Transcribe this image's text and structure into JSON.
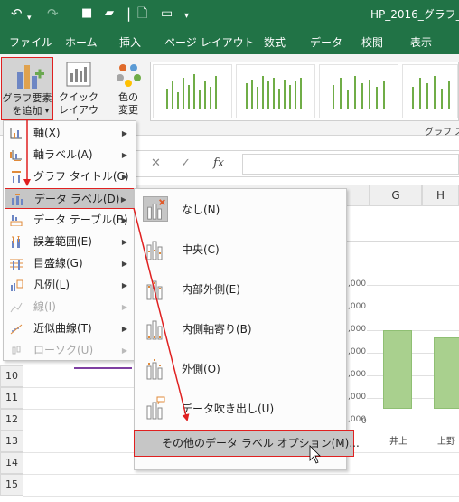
{
  "window": {
    "title": "HP_2016_グラフ_デ"
  },
  "quick_access": {
    "undo": "↶",
    "redo": "↷",
    "save": "■",
    "folder": "▰",
    "new": "🗋",
    "print": "▭",
    "more": "▾"
  },
  "tabs": [
    "ファイル",
    "ホーム",
    "挿入",
    "ページ レイアウト",
    "数式",
    "データ",
    "校閲",
    "表示"
  ],
  "ribbon": {
    "add_element": {
      "line1": "グラフ要素",
      "line2": "を追加"
    },
    "quick_layout": {
      "line1": "クイック",
      "line2": "レイアウト"
    },
    "change_color": {
      "line1": "色の",
      "line2": "変更"
    },
    "group_label": "グラフ ス"
  },
  "formula_bar": {
    "cancel": "✕",
    "enter": "✓",
    "fx": "fx",
    "value": ""
  },
  "columns": [
    "G",
    "H"
  ],
  "rows": [
    "10",
    "11",
    "12",
    "13",
    "14",
    "15"
  ],
  "chart": {
    "yticks": [
      ",000",
      ",000",
      ",000",
      ",000",
      ",000",
      ",000",
      ",000",
      "0"
    ],
    "categories": [
      "井上",
      "上野"
    ],
    "bar_fraction": [
      0.575,
      0.523
    ]
  },
  "menu": {
    "items": [
      {
        "label": "軸(X)",
        "disabled": false,
        "icon": "axes-icon"
      },
      {
        "label": "軸ラベル(A)",
        "disabled": false,
        "icon": "axis-titles-icon"
      },
      {
        "label": "グラフ タイトル(C)",
        "disabled": false,
        "icon": "chart-title-icon"
      },
      {
        "label": "データ ラベル(D)",
        "disabled": false,
        "icon": "data-labels-icon"
      },
      {
        "label": "データ テーブル(B)",
        "disabled": false,
        "icon": "data-table-icon"
      },
      {
        "label": "誤差範囲(E)",
        "disabled": false,
        "icon": "error-bars-icon"
      },
      {
        "label": "目盛線(G)",
        "disabled": false,
        "icon": "gridlines-icon"
      },
      {
        "label": "凡例(L)",
        "disabled": false,
        "icon": "legend-icon"
      },
      {
        "label": "線(I)",
        "disabled": true,
        "icon": "lines-icon"
      },
      {
        "label": "近似曲線(T)",
        "disabled": false,
        "icon": "trendline-icon"
      },
      {
        "label": "ローソク(U)",
        "disabled": true,
        "icon": "up-down-bars-icon"
      }
    ]
  },
  "submenu": {
    "items": [
      {
        "label": "なし(N)",
        "icon": "none-icon"
      },
      {
        "label": "中央(C)",
        "icon": "center-icon"
      },
      {
        "label": "内部外側(E)",
        "icon": "inside-end-icon"
      },
      {
        "label": "内側軸寄り(B)",
        "icon": "inside-base-icon"
      },
      {
        "label": "外側(O)",
        "icon": "outside-end-icon"
      },
      {
        "label": "データ吹き出し(U)",
        "icon": "data-callout-icon"
      }
    ],
    "more_options": "その他のデータ ラベル オプション(M)..."
  },
  "colors": {
    "brand": "#217346",
    "annotation": "#e02020",
    "bar": "#a9d08e"
  }
}
